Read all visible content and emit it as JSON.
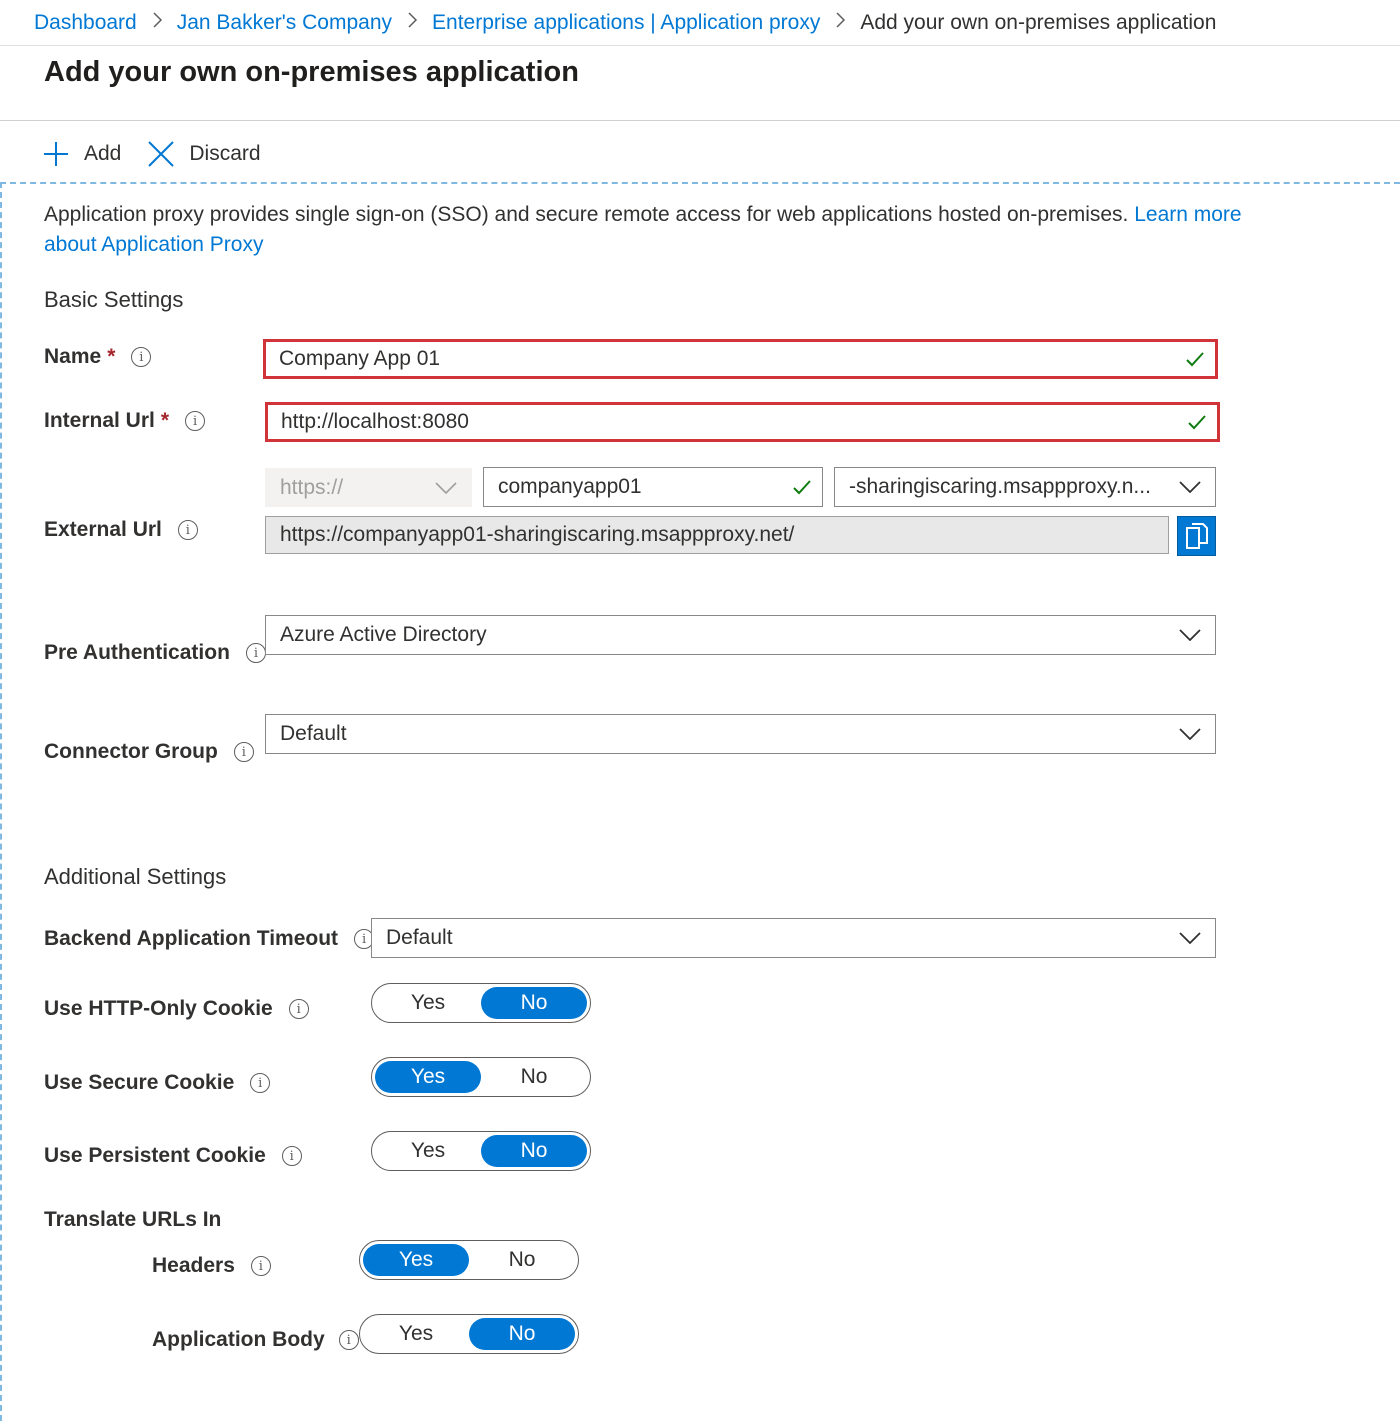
{
  "breadcrumb": {
    "items": [
      "Dashboard",
      "Jan Bakker's Company",
      "Enterprise applications | Application proxy"
    ],
    "current": "Add your own on-premises application"
  },
  "page_title": "Add your own on-premises application",
  "toolbar": {
    "add_label": "Add",
    "discard_label": "Discard"
  },
  "intro": {
    "text": "Application proxy provides single sign-on (SSO) and secure remote access for web applications hosted on-premises.",
    "link": "Learn more about Application Proxy"
  },
  "basic_settings": {
    "heading": "Basic Settings",
    "name": {
      "label": "Name",
      "value": "Company App 01"
    },
    "internal_url": {
      "label": "Internal Url",
      "value": "http://localhost:8080"
    },
    "external_url": {
      "label": "External Url",
      "protocol": "https://",
      "subdomain": "companyapp01",
      "domain": "-sharingiscaring.msappproxy.n...",
      "full": "https://companyapp01-sharingiscaring.msappproxy.net/"
    },
    "pre_authentication": {
      "label": "Pre Authentication",
      "value": "Azure Active Directory"
    },
    "connector_group": {
      "label": "Connector Group",
      "value": "Default"
    }
  },
  "additional_settings": {
    "heading": "Additional Settings",
    "backend_timeout": {
      "label": "Backend Application Timeout",
      "value": "Default"
    },
    "http_only_cookie": {
      "label": "Use HTTP-Only Cookie",
      "selected": "No"
    },
    "secure_cookie": {
      "label": "Use Secure Cookie",
      "selected": "Yes"
    },
    "persistent_cookie": {
      "label": "Use Persistent Cookie",
      "selected": "No"
    },
    "translate_urls": {
      "heading": "Translate URLs In",
      "headers": {
        "label": "Headers",
        "selected": "Yes"
      },
      "body": {
        "label": "Application Body",
        "selected": "No"
      }
    }
  },
  "toggle_options": {
    "yes": "Yes",
    "no": "No"
  },
  "required_mark": "*",
  "info_glyph": "i",
  "colors": {
    "accent": "#0078d4",
    "error_border": "#d13438",
    "valid_check": "#107c10"
  }
}
